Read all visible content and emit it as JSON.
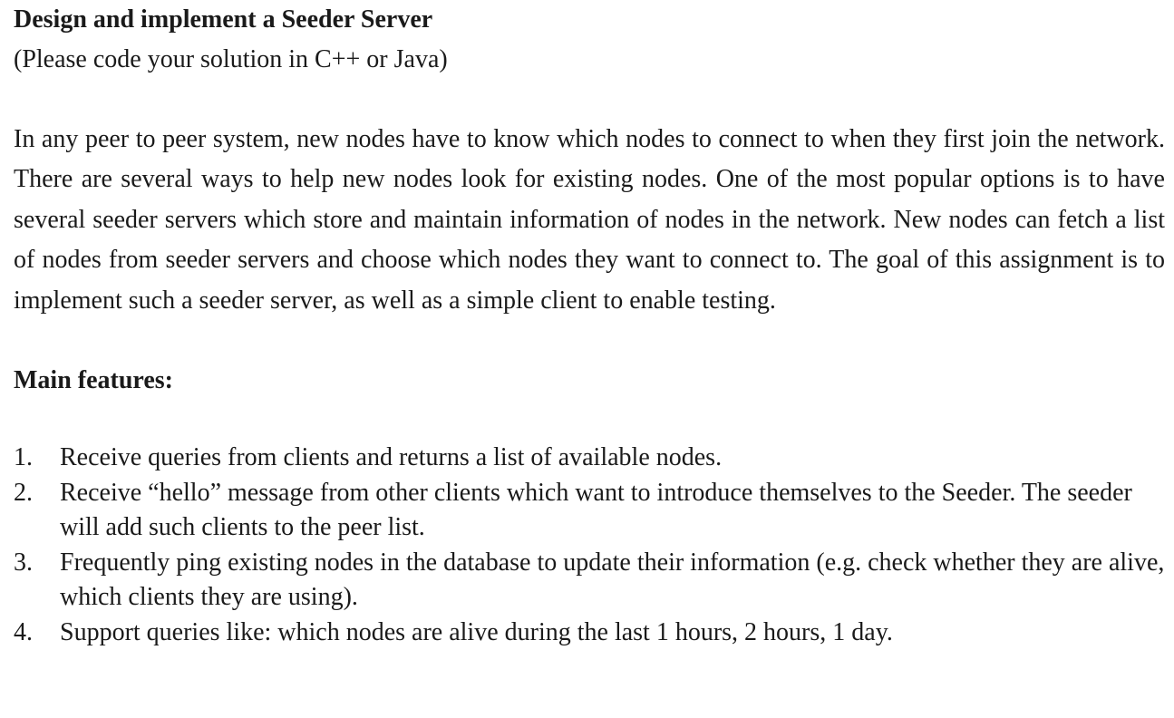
{
  "document": {
    "title": "Design and implement a Seeder Server",
    "subtitle": "(Please code your solution in C++ or Java)",
    "intro": "In any peer to peer system, new nodes have to know which nodes to connect to when they first join the network. There are several ways to help new nodes look for existing nodes. One of the most popular options is to have several seeder servers which store and maintain information of nodes in the network. New nodes can fetch a list of nodes from seeder servers and choose which nodes they want to connect to. The goal of this assignment is to implement such a seeder server, as well as a simple client to enable testing.",
    "features_heading": "Main features:",
    "features": [
      {
        "num": "1.",
        "text": "Receive queries from clients and returns a list of available nodes."
      },
      {
        "num": "2.",
        "text": "Receive “hello” message from other clients which want to introduce themselves to the Seeder. The seeder will add such clients to the peer list."
      },
      {
        "num": "3.",
        "text": "Frequently ping existing nodes in the database to update their information (e.g. check whether they are alive, which clients they are using)."
      },
      {
        "num": "4.",
        "text": "Support queries like: which nodes are alive during the last 1 hours, 2 hours, 1 day."
      }
    ]
  }
}
